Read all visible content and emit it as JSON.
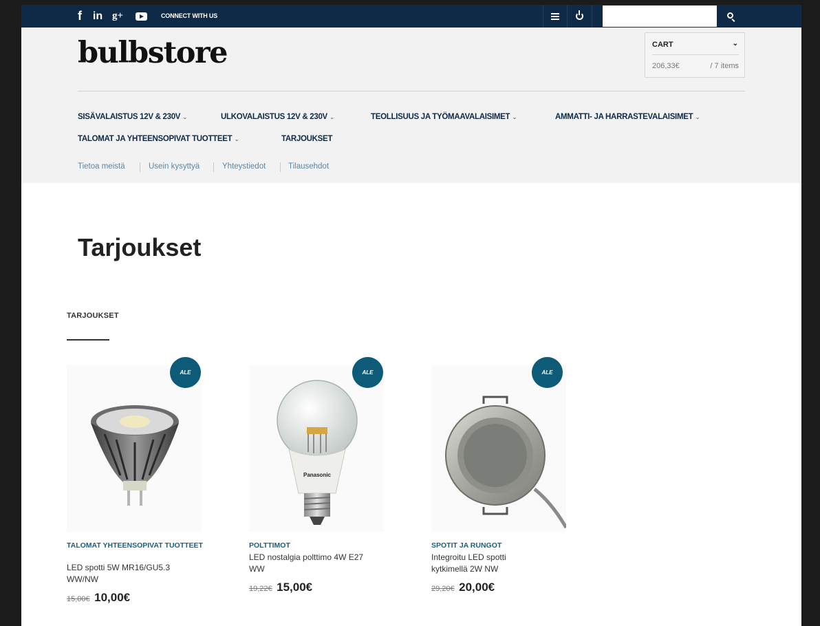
{
  "topbar": {
    "social_icons": [
      "facebook-icon",
      "linkedin-icon",
      "google-plus-icon",
      "youtube-icon"
    ],
    "facebook_glyph": "f",
    "linkedin_glyph": "in",
    "googleplus_glyph": "g+",
    "connect_label": "CONNECT WITH US",
    "search_placeholder": ""
  },
  "header": {
    "logo": "bulbstore",
    "cart": {
      "label": "CART",
      "total": "206,33€",
      "items": "/ 7 items"
    },
    "nav": [
      {
        "label": "SISÄVALAISTUS 12V & 230V",
        "dropdown": true
      },
      {
        "label": "ULKOVALAISTUS 12V & 230V",
        "dropdown": true
      },
      {
        "label": "TEOLLISUUS JA TYÖMAAVALAISIMET",
        "dropdown": true
      },
      {
        "label": "AMMATTI- JA HARRASTEVALAISIMET",
        "dropdown": true
      },
      {
        "label": "TALOMAT JA YHTEENSOPIVAT TUOTTEET",
        "dropdown": true
      },
      {
        "label": "TARJOUKSET",
        "dropdown": false
      }
    ],
    "subnav": [
      "Tietoa meistä",
      "Usein kysyttyä",
      "Yhteystiedot",
      "Tilausehdot"
    ]
  },
  "page": {
    "title": "Tarjoukset",
    "section_title": "TARJOUKSET"
  },
  "products": [
    {
      "badge": "ALE",
      "category": "TALOMAT YHTEENSOPIVAT TUOTTEET",
      "name": "LED spotti 5W MR16/GU5.3 WW/NW",
      "old_price": "15,00€",
      "price": "10,00€",
      "image": "led-spot-mr16-icon"
    },
    {
      "badge": "ALE",
      "category": "POLTTIMOT",
      "name": "LED nostalgia polttimo 4W E27 WW",
      "old_price": "19,22€",
      "price": "15,00€",
      "image": "led-bulb-e27-icon",
      "image_brand_text": "Panasonic"
    },
    {
      "badge": "ALE",
      "category": "SPOTIT JA RUNGOT",
      "name": "Integroitu LED spotti kytkimellä 2W NW",
      "old_price": "29,20€",
      "price": "20,00€",
      "image": "recessed-spot-icon"
    }
  ],
  "colors": {
    "topbar": "#0e2a47",
    "header_bg": "#f2f2f2",
    "badge": "#0e5b78",
    "category": "#1a6080",
    "subnav": "#5a86a8"
  }
}
